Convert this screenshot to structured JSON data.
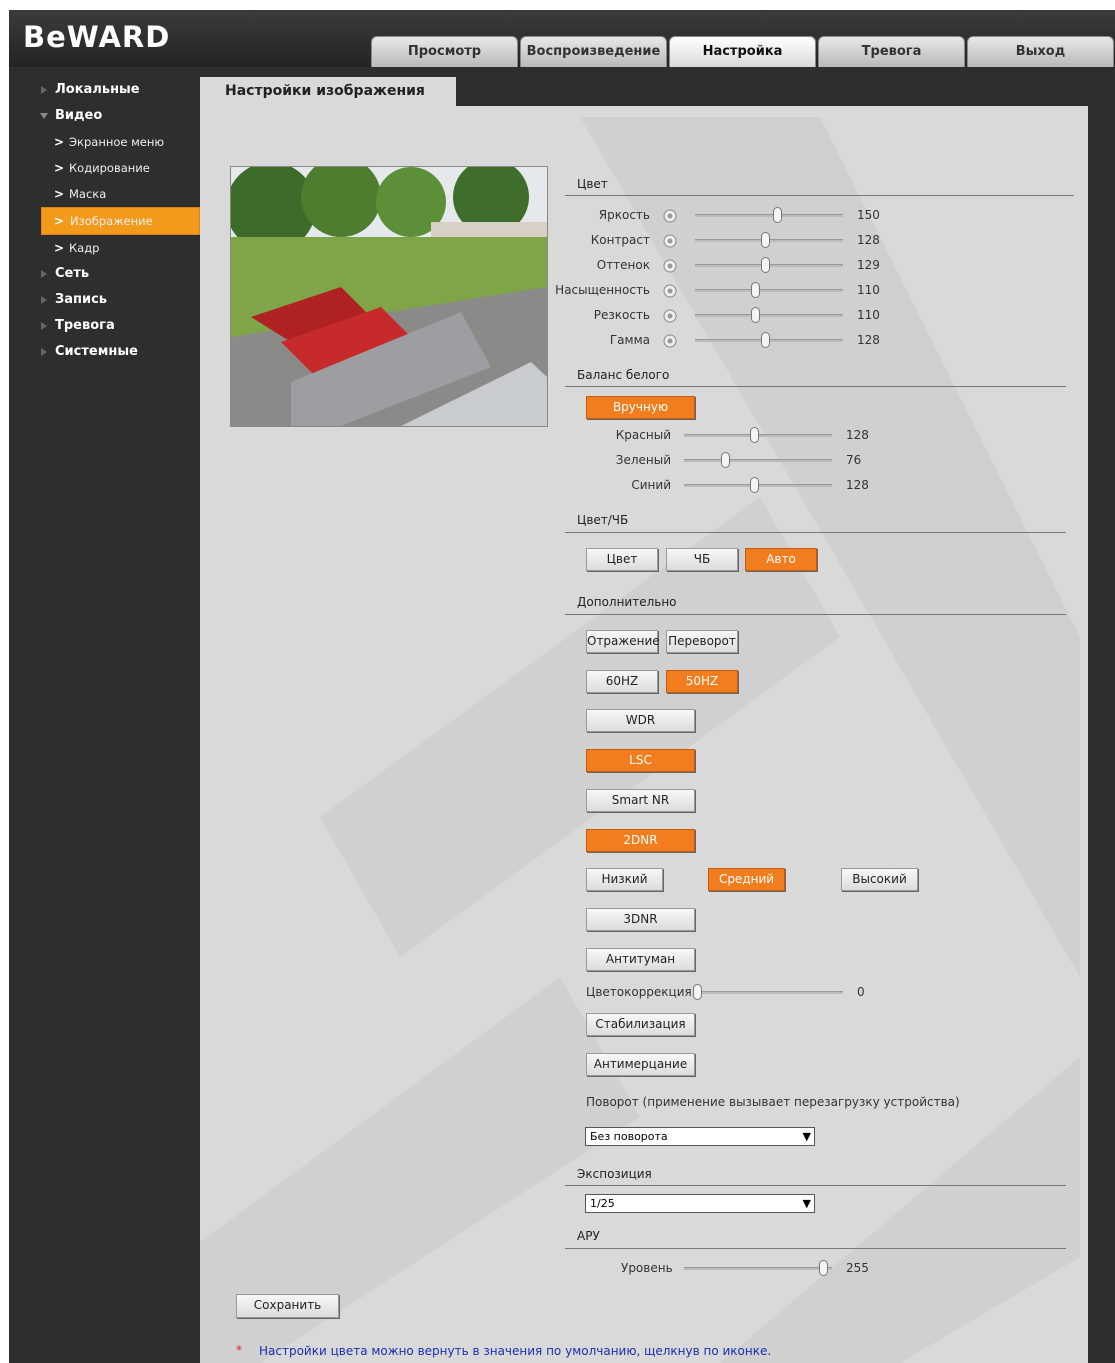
{
  "logo": "BeWARD",
  "tabs": [
    "Просмотр",
    "Воспроизведение",
    "Настройка",
    "Тревога",
    "Выход"
  ],
  "sidebar": {
    "local": "Локальные",
    "video": "Видео",
    "video_items": [
      "Экранное меню",
      "Кодирование",
      "Маска",
      "Изображение",
      "Кадр"
    ],
    "network": "Сеть",
    "record": "Запись",
    "alarm": "Тревога",
    "system": "Системные"
  },
  "page_title": "Настройки изображения",
  "color": {
    "section": "Цвет",
    "items": [
      {
        "label": "Яркость",
        "value": "150",
        "level": 150
      },
      {
        "label": "Контраст",
        "value": "128",
        "level": 128
      },
      {
        "label": "Оттенок",
        "value": "129",
        "level": 129
      },
      {
        "label": "Насыщенность",
        "value": "110",
        "level": 110
      },
      {
        "label": "Резкость",
        "value": "110",
        "level": 110
      },
      {
        "label": "Гамма",
        "value": "128",
        "level": 128
      }
    ]
  },
  "white_balance": {
    "section": "Баланс белого",
    "mode": "Вручную",
    "items": [
      {
        "label": "Красный",
        "value": "128",
        "level": 128
      },
      {
        "label": "Зеленый",
        "value": "76",
        "level": 76
      },
      {
        "label": "Синий",
        "value": "128",
        "level": 128
      }
    ]
  },
  "color_bw": {
    "section": "Цвет/ЧБ",
    "options": [
      "Цвет",
      "ЧБ",
      "Авто"
    ],
    "selected": "Авто"
  },
  "extra": {
    "section": "Дополнительно",
    "mirror": "Отражение",
    "flip": "Переворот",
    "hz60": "60HZ",
    "hz50": "50HZ",
    "wdr": "WDR",
    "lsc": "LSC",
    "smart_nr": "Smart NR",
    "dnr2": "2DNR",
    "low": "Низкий",
    "mid": "Средний",
    "high": "Высокий",
    "dnr3": "3DNR",
    "defog": "Антитуман",
    "color_correction_label": "Цветокоррекция",
    "color_correction_value": "0",
    "stabilization": "Стабилизация",
    "antiflicker": "Антимерцание",
    "rotate_label": "Поворот (применение вызывает перезагрузку устройства)",
    "rotate_value": "Без поворота"
  },
  "exposure": {
    "section": "Экспозиция",
    "value": "1/25"
  },
  "agc": {
    "section": "АРУ",
    "level_label": "Уровень",
    "level_value": "255",
    "level": 255
  },
  "save": "Сохранить",
  "note_star": "*",
  "note": "Настройки цвета можно вернуть в значения по умолчанию, щелкнув по иконке.",
  "colors": {
    "accent": "#f27d1f",
    "background": "#d9d9d9",
    "dark": "#2e2e2e"
  }
}
